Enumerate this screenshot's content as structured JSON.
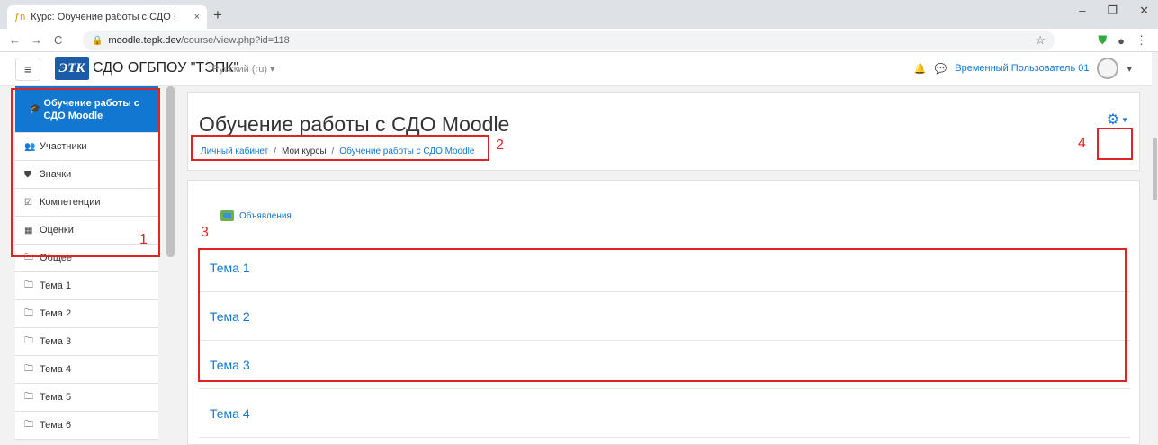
{
  "browser": {
    "tab_title": "Курс: Обучение работы с СДО I",
    "url_host": "moodle.tepk.dev",
    "url_path": "/course/view.php?id=118",
    "new_tab": "+",
    "tab_close": "×"
  },
  "navbar": {
    "site_name": "СДО ОГБПОУ \"ТЭПК\"",
    "logo_text": "ЭТК",
    "language": "Русский (ru) ▾",
    "user_name": "Временный Пользователь 01"
  },
  "drawer": {
    "course_label": "Обучение работы с СДО Moodle",
    "items": [
      {
        "label": "Участники",
        "icon": "users-icon"
      },
      {
        "label": "Значки",
        "icon": "shield-icon"
      },
      {
        "label": "Компетенции",
        "icon": "checkbox-icon"
      },
      {
        "label": "Оценки",
        "icon": "table-icon"
      },
      {
        "label": "Общее",
        "icon": "folder-icon"
      },
      {
        "label": "Тема 1",
        "icon": "folder-icon"
      },
      {
        "label": "Тема 2",
        "icon": "folder-icon"
      },
      {
        "label": "Тема 3",
        "icon": "folder-icon"
      },
      {
        "label": "Тема 4",
        "icon": "folder-icon"
      },
      {
        "label": "Тема 5",
        "icon": "folder-icon"
      },
      {
        "label": "Тема 6",
        "icon": "folder-icon"
      }
    ]
  },
  "course": {
    "title": "Обучение работы с СДО Moodle",
    "breadcrumb": [
      "Личный кабинет",
      "Мои курсы",
      "Обучение работы с СДО Moodle"
    ],
    "forum_label": "Объявления",
    "sections": [
      "Тема 1",
      "Тема 2",
      "Тема 3",
      "Тема 4"
    ]
  },
  "annotations": [
    "1",
    "2",
    "3",
    "4"
  ],
  "colors": {
    "accent": "#1177d1",
    "annotation": "#e02424"
  }
}
